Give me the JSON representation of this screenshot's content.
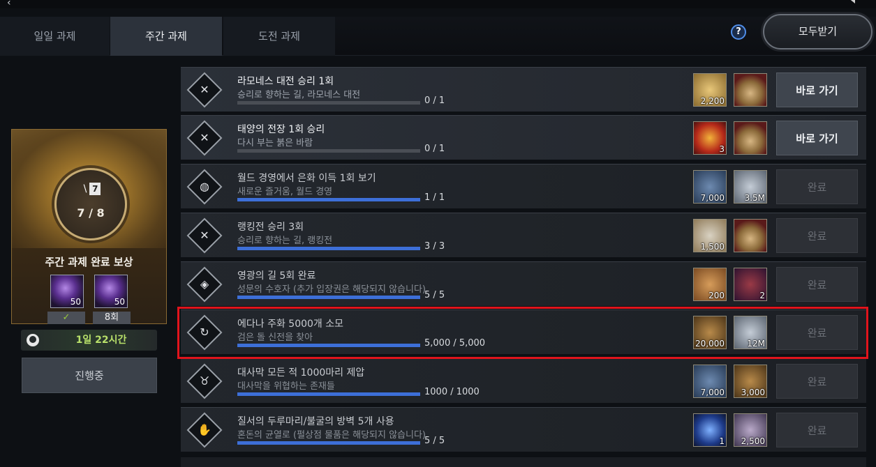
{
  "tabs": [
    {
      "label": "일일 과제",
      "active": false
    },
    {
      "label": "주간 과제",
      "active": true
    },
    {
      "label": "도전 과제",
      "active": false
    }
  ],
  "header": {
    "help": "?",
    "receive_all": "모두받기"
  },
  "reward_panel": {
    "progress": "7 / 8",
    "badge_value": "7",
    "title": "주간 과제 완료 보상",
    "items": [
      {
        "count": "50"
      },
      {
        "count": "50"
      }
    ],
    "check": "✓",
    "count_label": "8회",
    "timer": "1일 22시간",
    "status": "진행중"
  },
  "quests": [
    {
      "title": "라모네스 대전 승리 1회",
      "sub": "승리로 향하는 길, 라모네스 대전",
      "progress_text": "0 / 1",
      "progress": 0,
      "icon": "crossed-swords-icon",
      "rewards": [
        {
          "count": "2,200",
          "icon": "silver-plate-icon",
          "color": "bg-gold"
        },
        {
          "count": "",
          "icon": "medal-icon",
          "color": "bg-medal"
        }
      ],
      "action": "바로 가기",
      "done": false
    },
    {
      "title": "태양의 전장 1회 승리",
      "sub": "다시 부는 붉은 바람",
      "progress_text": "0 / 1",
      "progress": 0,
      "icon": "crossed-swords-icon",
      "rewards": [
        {
          "count": "3",
          "icon": "red-crystal-icon",
          "color": "bg-red"
        },
        {
          "count": "",
          "icon": "medal-icon",
          "color": "bg-medal"
        }
      ],
      "action": "바로 가기",
      "done": false
    },
    {
      "title": "월드 경영에서 은화 이득 1회 보기",
      "sub": "새로운 즐거움, 월드 경영",
      "progress_text": "1 / 1",
      "progress": 1,
      "icon": "globe-icon",
      "rewards": [
        {
          "count": "7,000",
          "icon": "ore-icon",
          "color": "bg-blue"
        },
        {
          "count": "3.5M",
          "icon": "silver-coin-icon",
          "color": "bg-silver"
        }
      ],
      "action": "완료",
      "done": true
    },
    {
      "title": "랭킹전 승리 3회",
      "sub": "승리로 향하는 길, 랭킹전",
      "progress_text": "3 / 3",
      "progress": 1,
      "icon": "crossed-swords-icon",
      "rewards": [
        {
          "count": "1,500",
          "icon": "scroll-icon",
          "color": "bg-scroll"
        },
        {
          "count": "",
          "icon": "medal-icon",
          "color": "bg-medal"
        }
      ],
      "action": "완료",
      "done": true
    },
    {
      "title": "영광의 길 5회 완료",
      "sub": "성문의 수호자 (추가 입장권은 해당되지 않습니다)",
      "progress_text": "5 / 5",
      "progress": 1,
      "icon": "diamond-gate-icon",
      "rewards": [
        {
          "count": "200",
          "icon": "copper-coin-icon",
          "color": "bg-copper"
        },
        {
          "count": "2",
          "icon": "scorpion-card-icon",
          "color": "bg-crimson"
        }
      ],
      "action": "완료",
      "done": true
    },
    {
      "title": "에다나 주화 5000개 소모",
      "sub": "검은 돌 신전을 찾아",
      "progress_text": "5,000 / 5,000",
      "progress": 1,
      "icon": "cycle-icon",
      "rewards": [
        {
          "count": "20,000",
          "icon": "fire-pile-icon",
          "color": "bg-bronze"
        },
        {
          "count": "12M",
          "icon": "silver-coin-icon",
          "color": "bg-silver"
        }
      ],
      "action": "완료",
      "done": true
    },
    {
      "title": "대사막 모든 적 1000마리 제압",
      "sub": "대사막을 위협하는 존재들",
      "progress_text": "1000 / 1000",
      "progress": 1,
      "icon": "bull-head-icon",
      "rewards": [
        {
          "count": "7,000",
          "icon": "ore-icon",
          "color": "bg-blue"
        },
        {
          "count": "3,000",
          "icon": "gold-coin-icon",
          "color": "bg-bronze"
        }
      ],
      "action": "완료",
      "done": true
    },
    {
      "title": "질서의 두루마리/불굴의 방벽 5개 사용",
      "sub": "혼돈의 균열로 (펄상점 물품은 해당되지 않습니다)",
      "progress_text": "5 / 5",
      "progress": 1,
      "icon": "hand-icon",
      "rewards": [
        {
          "count": "1",
          "icon": "blue-orb-icon",
          "color": "bg-orb"
        },
        {
          "count": "2,500",
          "icon": "purple-coin-icon",
          "color": "bg-purple"
        }
      ],
      "action": "완료",
      "done": true
    }
  ]
}
